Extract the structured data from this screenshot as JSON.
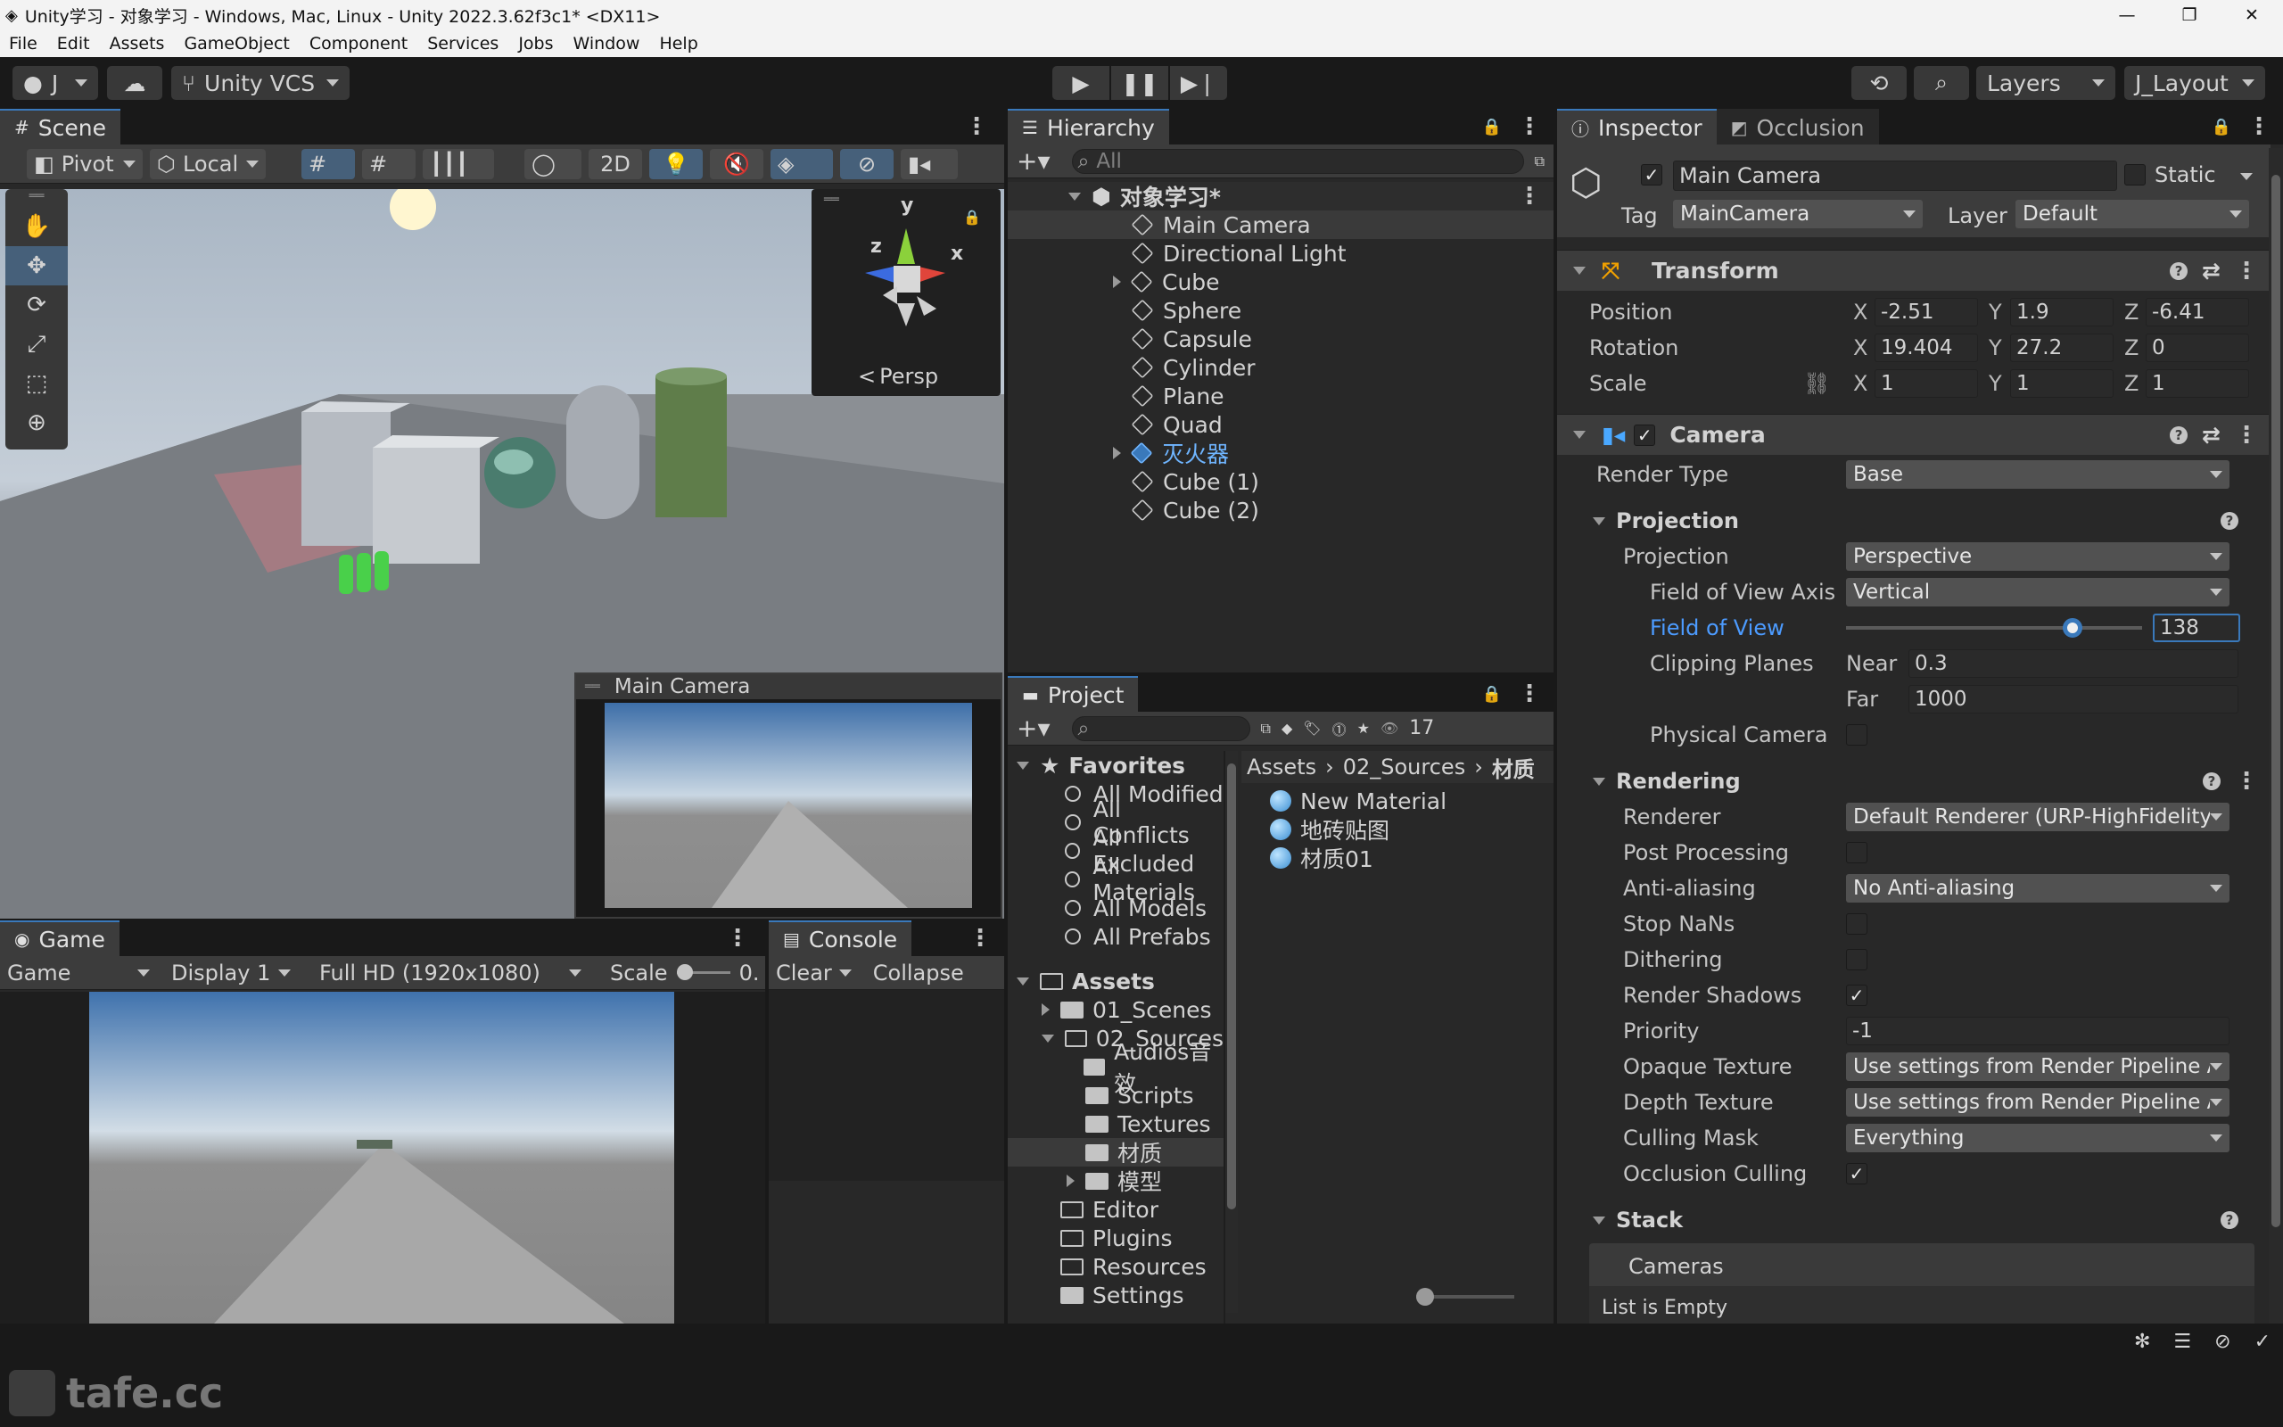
{
  "window": {
    "title": "Unity学习 - 对象学习 - Windows, Mac, Linux - Unity 2022.3.62f3c1* <DX11>",
    "min": "—",
    "max": "❐",
    "close": "✕"
  },
  "menu": [
    "File",
    "Edit",
    "Assets",
    "GameObject",
    "Component",
    "Services",
    "Jobs",
    "Window",
    "Help"
  ],
  "toolbar": {
    "account": "J",
    "vcs": "Unity VCS",
    "layers": "Layers",
    "layout": "J_Layout"
  },
  "scene": {
    "tab": "Scene",
    "pivot": "Pivot",
    "local": "Local",
    "mode2d": "2D",
    "persp": "Persp",
    "gizmo": {
      "y": "y",
      "x": "x",
      "z": "z"
    },
    "camera_preview_title": "Main Camera"
  },
  "hierarchy": {
    "tab": "Hierarchy",
    "search_placeholder": "All",
    "scene_name": "对象学习*",
    "items": [
      {
        "label": "Main Camera",
        "selected": true,
        "expandable": false,
        "prefab": false
      },
      {
        "label": "Directional Light",
        "expandable": false,
        "prefab": false
      },
      {
        "label": "Cube",
        "expandable": true,
        "prefab": false
      },
      {
        "label": "Sphere",
        "expandable": false,
        "prefab": false
      },
      {
        "label": "Capsule",
        "expandable": false,
        "prefab": false
      },
      {
        "label": "Cylinder",
        "expandable": false,
        "prefab": false
      },
      {
        "label": "Plane",
        "expandable": false,
        "prefab": false
      },
      {
        "label": "Quad",
        "expandable": false,
        "prefab": false
      },
      {
        "label": "灭火器",
        "expandable": true,
        "prefab": true
      },
      {
        "label": "Cube (1)",
        "expandable": false,
        "prefab": false
      },
      {
        "label": "Cube (2)",
        "expandable": false,
        "prefab": false
      }
    ]
  },
  "project": {
    "tab": "Project",
    "hidden_count": "17",
    "breadcrumb": [
      "Assets",
      "02_Sources",
      "材质"
    ],
    "favorites_label": "Favorites",
    "favorites": [
      "All Modified",
      "All Conflicts",
      "All Excluded",
      "All Materials",
      "All Models",
      "All Prefabs"
    ],
    "assets_label": "Assets",
    "folders": [
      {
        "label": "01_Scenes",
        "indent": 1,
        "arrow": "right"
      },
      {
        "label": "02_Sources",
        "indent": 1,
        "arrow": "down",
        "open": true
      },
      {
        "label": "Audios音效",
        "indent": 2
      },
      {
        "label": "Scripts",
        "indent": 2
      },
      {
        "label": "Textures",
        "indent": 2
      },
      {
        "label": "材质",
        "indent": 2,
        "selected": true
      },
      {
        "label": "模型",
        "indent": 2,
        "arrow": "right"
      },
      {
        "label": "Editor",
        "indent": 1,
        "empty": true
      },
      {
        "label": "Plugins",
        "indent": 1,
        "empty": true
      },
      {
        "label": "Resources",
        "indent": 1,
        "empty": true
      },
      {
        "label": "Settings",
        "indent": 1
      }
    ],
    "files": [
      "New Material",
      "地砖贴图",
      "材质01"
    ]
  },
  "game": {
    "tab": "Game",
    "mode": "Game",
    "display": "Display 1",
    "resolution": "Full HD (1920x1080)",
    "scale_label": "Scale",
    "scale_value": "0."
  },
  "console": {
    "tab": "Console",
    "clear": "Clear",
    "collapse": "Collapse"
  },
  "inspector": {
    "tab": "Inspector",
    "tab2": "Occlusion",
    "object_name": "Main Camera",
    "static_label": "Static",
    "tag_label": "Tag",
    "tag": "MainCamera",
    "layer_label": "Layer",
    "layer": "Default",
    "transform": {
      "title": "Transform",
      "rows": [
        {
          "label": "Position",
          "x": "-2.51",
          "y": "1.9",
          "z": "-6.41"
        },
        {
          "label": "Rotation",
          "x": "19.404",
          "y": "27.2",
          "z": "0"
        },
        {
          "label": "Scale",
          "x": "1",
          "y": "1",
          "z": "1"
        }
      ]
    },
    "camera": {
      "title": "Camera",
      "render_type_label": "Render Type",
      "render_type": "Base",
      "projection_section": "Projection",
      "projection_label": "Projection",
      "projection": "Perspective",
      "fov_axis_label": "Field of View Axis",
      "fov_axis": "Vertical",
      "fov_label": "Field of View",
      "fov_value": "138",
      "fov_fraction": 0.765,
      "clip_label": "Clipping Planes",
      "near_label": "Near",
      "near": "0.3",
      "far_label": "Far",
      "far": "1000",
      "physical_label": "Physical Camera",
      "rendering_section": "Rendering",
      "renderer_label": "Renderer",
      "renderer": "Default Renderer (URP-HighFidelity",
      "post_label": "Post Processing",
      "aa_label": "Anti-aliasing",
      "aa": "No Anti-aliasing",
      "nan_label": "Stop NaNs",
      "dither_label": "Dithering",
      "shadows_label": "Render Shadows",
      "priority_label": "Priority",
      "priority": "-1",
      "opaque_label": "Opaque Texture",
      "opaque": "Use settings from Render Pipeline As",
      "depth_label": "Depth Texture",
      "depth": "Use settings from Render Pipeline As",
      "culling_label": "Culling Mask",
      "culling": "Everything",
      "occlusion_label": "Occlusion Culling",
      "stack_section": "Stack",
      "cameras_label": "Cameras",
      "list_empty": "List is Empty"
    }
  },
  "watermark": "tafe.cc",
  "colors": {
    "accent": "#3a79bb",
    "link": "#4c9bff",
    "panel": "#282828",
    "header": "#3c3c3c"
  }
}
